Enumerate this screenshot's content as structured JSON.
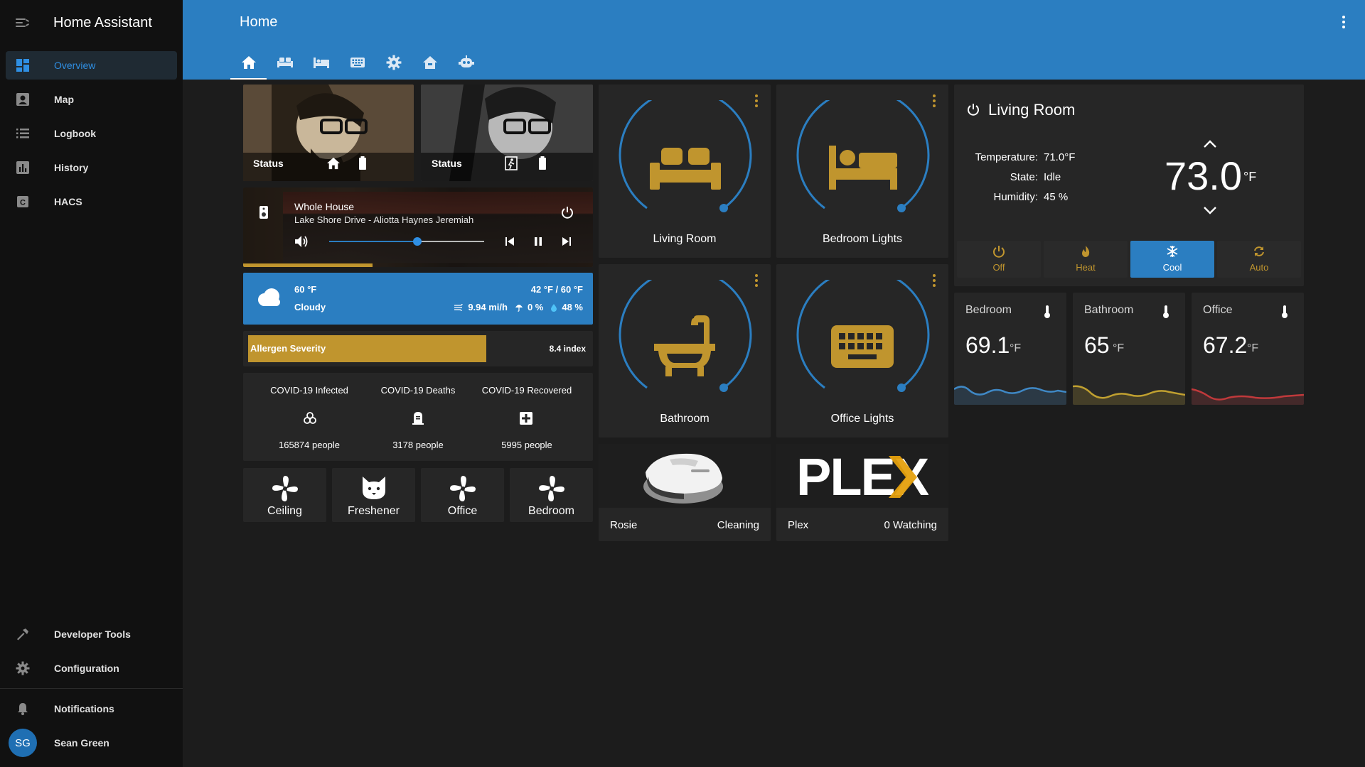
{
  "app": {
    "title": "Home Assistant"
  },
  "sidebar": {
    "items": [
      {
        "label": "Overview",
        "icon": "dashboard-icon"
      },
      {
        "label": "Map",
        "icon": "account-box-icon"
      },
      {
        "label": "Logbook",
        "icon": "list-icon"
      },
      {
        "label": "History",
        "icon": "chart-icon"
      },
      {
        "label": "HACS",
        "icon": "hacs-icon"
      }
    ],
    "bottom": [
      {
        "label": "Developer Tools",
        "icon": "hammer-icon"
      },
      {
        "label": "Configuration",
        "icon": "gear-icon"
      },
      {
        "label": "Notifications",
        "icon": "bell-icon"
      }
    ],
    "user": {
      "initials": "SG",
      "name": "Sean Green"
    }
  },
  "header": {
    "title": "Home",
    "tabs": [
      "home-icon",
      "sofa-icon",
      "bed-icon",
      "keyboard-icon",
      "gear-icon",
      "house-outline-icon",
      "robot-icon"
    ]
  },
  "pictures": [
    {
      "label": "Status"
    },
    {
      "label": "Status"
    }
  ],
  "media": {
    "title": "Whole House",
    "subtitle": "Lake Shore Drive - Aliotta Haynes Jeremiah",
    "progress": 0.37,
    "volume": 0.57
  },
  "weather": {
    "temp": "60 °F",
    "condition": "Cloudy",
    "hilo": "42 °F / 60 °F",
    "wind": "9.94 mi/h",
    "precip": "0 %",
    "humidity": "48 %"
  },
  "allergen": {
    "label": "Allergen Severity",
    "value": "8.4 index",
    "fill": 0.7
  },
  "covid": [
    {
      "label": "COVID-19 Infected",
      "value": "165874 people",
      "icon": "biohazard-icon"
    },
    {
      "label": "COVID-19 Deaths",
      "value": "3178 people",
      "icon": "grave-icon"
    },
    {
      "label": "COVID-19 Recovered",
      "value": "5995 people",
      "icon": "medical-cross-icon"
    }
  ],
  "fans": [
    {
      "label": "Ceiling",
      "icon": "fan-icon"
    },
    {
      "label": "Freshener",
      "icon": "cat-icon"
    },
    {
      "label": "Office",
      "icon": "fan-icon"
    },
    {
      "label": "Bedroom",
      "icon": "fan-icon"
    }
  ],
  "lights": [
    {
      "label": "Living Room",
      "icon": "sofa-icon"
    },
    {
      "label": "Bedroom Lights",
      "icon": "bed-icon"
    },
    {
      "label": "Bathroom",
      "icon": "bathtub-icon"
    },
    {
      "label": "Office Lights",
      "icon": "keyboard-icon"
    }
  ],
  "vacuum": {
    "name": "Rosie",
    "state": "Cleaning"
  },
  "plex": {
    "logo": "PLEX",
    "name": "Plex",
    "state": "0 Watching"
  },
  "thermostat": {
    "name": "Living Room",
    "temperature_label": "Temperature:",
    "temperature_value": "71.0°F",
    "state_label": "State:",
    "state_value": "Idle",
    "humidity_label": "Humidity:",
    "humidity_value": "45 %",
    "target": "73.0",
    "unit": "°F",
    "modes": [
      "Off",
      "Heat",
      "Cool",
      "Auto"
    ],
    "active_mode": "Cool"
  },
  "sensors": [
    {
      "name": "Bedroom",
      "value": "69.1",
      "unit": "°F",
      "color": "#3f88c5"
    },
    {
      "name": "Bathroom",
      "value": "65",
      "unit": "°F",
      "color": "#c0a030"
    },
    {
      "name": "Office",
      "value": "67.2",
      "unit": "°F",
      "color": "#c0393b"
    }
  ],
  "colors": {
    "accent": "#2b7ec1",
    "gold": "#c0952e",
    "sidebar": "#111111",
    "card": "#262626"
  }
}
